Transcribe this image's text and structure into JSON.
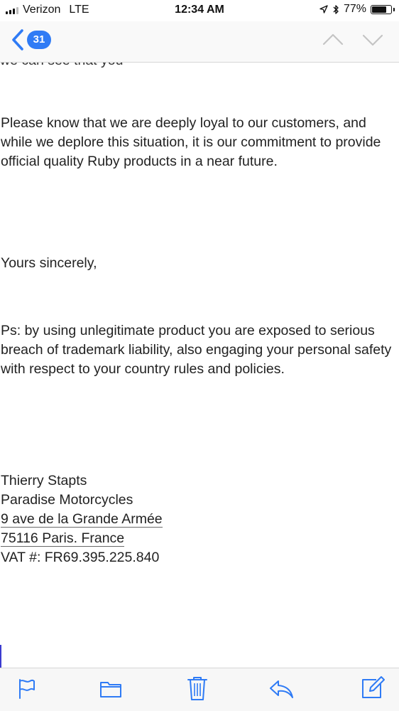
{
  "status_bar": {
    "carrier": "Verizon",
    "network": "LTE",
    "time": "12:34 AM",
    "battery": "77%",
    "battery_level": 0.77
  },
  "nav": {
    "unread_count": "31"
  },
  "email": {
    "clipped_top_line": "we can see that you",
    "paragraph_1": "Please know that we are deeply loyal to our customers, and while we deplore this situation, it is our commitment to provide official quality Ruby products in a near future.",
    "closing": "Yours sincerely,",
    "ps": "Ps: by using unlegitimate product you are exposed to serious breach of trademark liability, also engaging your personal safety with respect to your country rules and policies.",
    "signature": {
      "name": "Thierry Stapts",
      "company": "Paradise Motorcycles",
      "street": "9 ave de la Grande Armée",
      "city": "75116 Paris. France",
      "vat": "VAT #: FR69.395.225.840"
    }
  },
  "toolbar": {
    "icons": [
      "flag-icon",
      "folder-icon",
      "trash-icon",
      "reply-icon",
      "compose-icon"
    ]
  },
  "colors": {
    "accent": "#2f7bf5",
    "text": "#222222",
    "separator": "#d6d6d6"
  }
}
